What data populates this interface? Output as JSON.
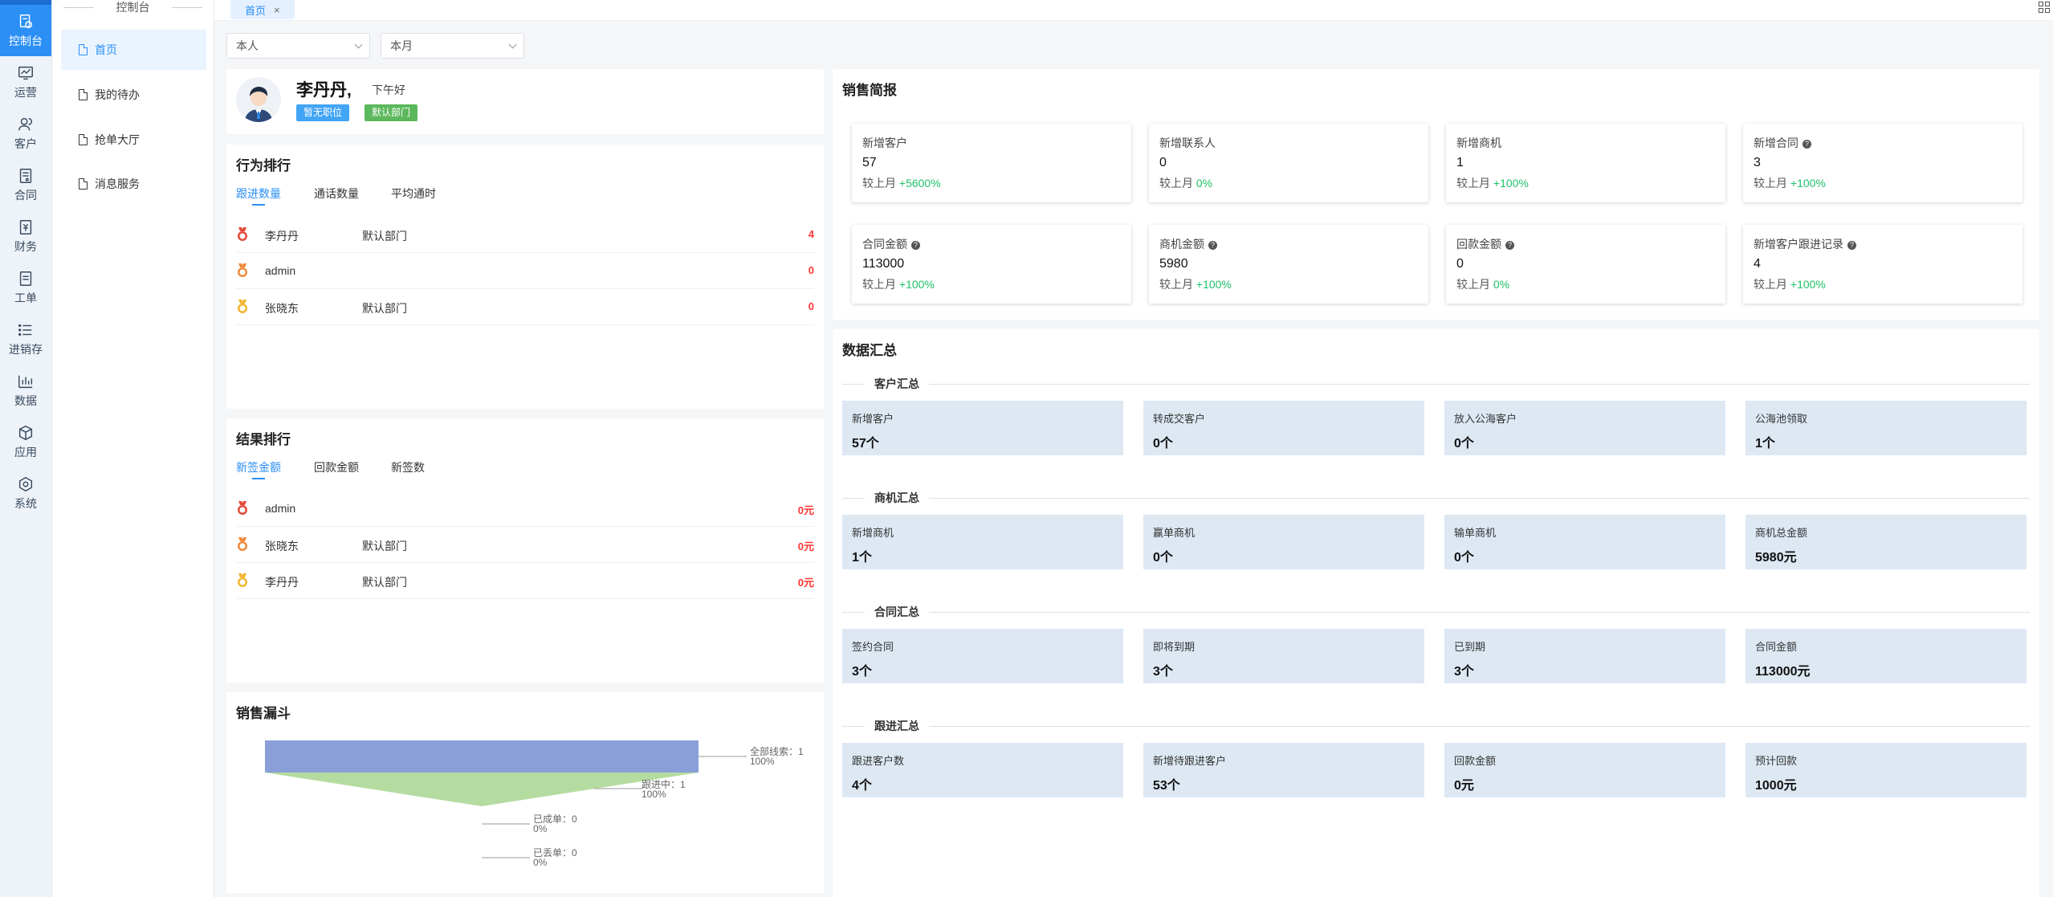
{
  "rail": {
    "items": [
      {
        "label": "控制台",
        "icon": "dashboard-icon",
        "active": true
      },
      {
        "label": "运营",
        "icon": "chart-monitor-icon"
      },
      {
        "label": "客户",
        "icon": "users-icon"
      },
      {
        "label": "合同",
        "icon": "contract-icon"
      },
      {
        "label": "财务",
        "icon": "finance-icon"
      },
      {
        "label": "工单",
        "icon": "ticket-icon"
      },
      {
        "label": "进销存",
        "icon": "list-icon"
      },
      {
        "label": "数据",
        "icon": "bar-chart-icon"
      },
      {
        "label": "应用",
        "icon": "cube-icon"
      },
      {
        "label": "系统",
        "icon": "hexagon-icon"
      }
    ],
    "accent": "#2b8ff5"
  },
  "submenu": {
    "title": "控制台",
    "items": [
      {
        "label": "首页",
        "active": true
      },
      {
        "label": "我的待办"
      },
      {
        "label": "抢单大厅"
      },
      {
        "label": "消息服务"
      }
    ]
  },
  "tabs": [
    {
      "label": "首页",
      "close": "×"
    }
  ],
  "filters": {
    "owner": "本人",
    "period": "本月"
  },
  "user": {
    "name": "李丹丹,",
    "greeting": "下午好",
    "tag_position": "暂无职位",
    "tag_dept": "默认部门"
  },
  "behavior_rank": {
    "title": "行为排行",
    "tabs": [
      "跟进数量",
      "通话数量",
      "平均通时"
    ],
    "rows": [
      {
        "name": "李丹丹",
        "dept": "默认部门",
        "value": "4"
      },
      {
        "name": "admin",
        "dept": "",
        "value": "0"
      },
      {
        "name": "张晓东",
        "dept": "默认部门",
        "value": "0"
      }
    ]
  },
  "result_rank": {
    "title": "结果排行",
    "tabs": [
      "新签金额",
      "回款金额",
      "新签数"
    ],
    "rows": [
      {
        "name": "admin",
        "dept": "",
        "value": "0元"
      },
      {
        "name": "张晓东",
        "dept": "默认部门",
        "value": "0元"
      },
      {
        "name": "李丹丹",
        "dept": "默认部门",
        "value": "0元"
      }
    ]
  },
  "funnel": {
    "title": "销售漏斗",
    "stages": [
      {
        "label": "全部线索：1",
        "pct": "100%"
      },
      {
        "label": "跟进中：1",
        "pct": "100%"
      },
      {
        "label": "已成单：0",
        "pct": "0%"
      },
      {
        "label": "已丢单：0",
        "pct": "0%"
      }
    ],
    "colors": [
      "#8a9fd8",
      "#b4dca0"
    ]
  },
  "sales_brief": {
    "title": "销售简报",
    "cards": [
      {
        "label": "新增客户",
        "q": false,
        "value": "57",
        "cmp": "较上月",
        "delta": "+5600%"
      },
      {
        "label": "新增联系人",
        "q": false,
        "value": "0",
        "cmp": "较上月",
        "delta": "0%"
      },
      {
        "label": "新增商机",
        "q": false,
        "value": "1",
        "cmp": "较上月",
        "delta": "+100%"
      },
      {
        "label": "新增合同",
        "q": true,
        "value": "3",
        "cmp": "较上月",
        "delta": "+100%"
      },
      {
        "label": "合同金额",
        "q": true,
        "value": "113000",
        "cmp": "较上月",
        "delta": "+100%"
      },
      {
        "label": "商机金额",
        "q": true,
        "value": "5980",
        "cmp": "较上月",
        "delta": "+100%"
      },
      {
        "label": "回款金额",
        "q": true,
        "value": "0",
        "cmp": "较上月",
        "delta": "0%"
      },
      {
        "label": "新增客户跟进记录",
        "q": true,
        "value": "4",
        "cmp": "较上月",
        "delta": "+100%"
      }
    ]
  },
  "summary": {
    "title": "数据汇总",
    "sections": [
      {
        "title": "客户汇总",
        "items": [
          {
            "label": "新增客户",
            "value": "57个"
          },
          {
            "label": "转成交客户",
            "value": "0个"
          },
          {
            "label": "放入公海客户",
            "value": "0个"
          },
          {
            "label": "公海池领取",
            "value": "1个"
          }
        ]
      },
      {
        "title": "商机汇总",
        "items": [
          {
            "label": "新增商机",
            "value": "1个"
          },
          {
            "label": "赢单商机",
            "value": "0个"
          },
          {
            "label": "输单商机",
            "value": "0个"
          },
          {
            "label": "商机总金额",
            "value": "5980元"
          }
        ]
      },
      {
        "title": "合同汇总",
        "items": [
          {
            "label": "签约合同",
            "value": "3个"
          },
          {
            "label": "即将到期",
            "value": "3个"
          },
          {
            "label": "已到期",
            "value": "3个"
          },
          {
            "label": "合同金额",
            "value": "113000元"
          }
        ]
      },
      {
        "title": "跟进汇总",
        "items": [
          {
            "label": "跟进客户数",
            "value": "4个"
          },
          {
            "label": "新增待跟进客户",
            "value": "53个"
          },
          {
            "label": "回款金额",
            "value": "0元"
          },
          {
            "label": "预计回款",
            "value": "1000元"
          }
        ]
      }
    ]
  }
}
